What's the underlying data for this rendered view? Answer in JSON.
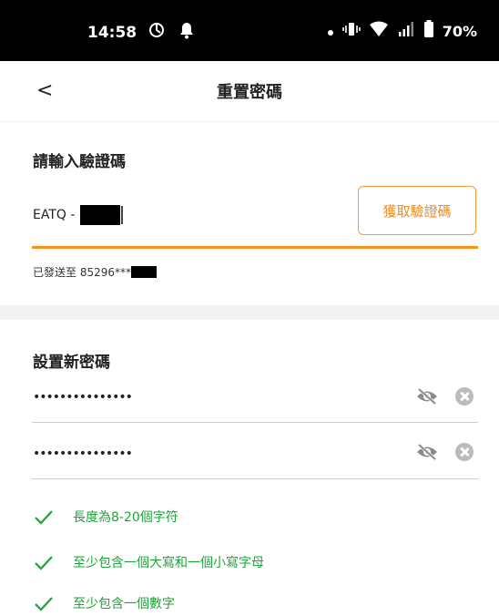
{
  "status_bar": {
    "time": "14:58",
    "battery": "70%"
  },
  "header": {
    "back_label": "<",
    "title": "重置密碼"
  },
  "verify": {
    "section_title": "請輸入驗證碼",
    "code_prefix": "EATQ -",
    "get_code_label": "獲取驗證碼",
    "sent_to_label": "已發送至 85296***"
  },
  "password": {
    "section_title": "設置新密碼",
    "new_value": "•••••••••••••••",
    "confirm_value": "•••••••••••••••"
  },
  "rules": [
    {
      "label": "長度為8-20個字符",
      "met": true
    },
    {
      "label": "至少包含一個大寫和一個小寫字母",
      "met": true
    },
    {
      "label": "至少包含一個數字",
      "met": true
    }
  ],
  "colors": {
    "accent": "#f5921e",
    "success": "#1fa33a",
    "status_bar": "#000000"
  }
}
